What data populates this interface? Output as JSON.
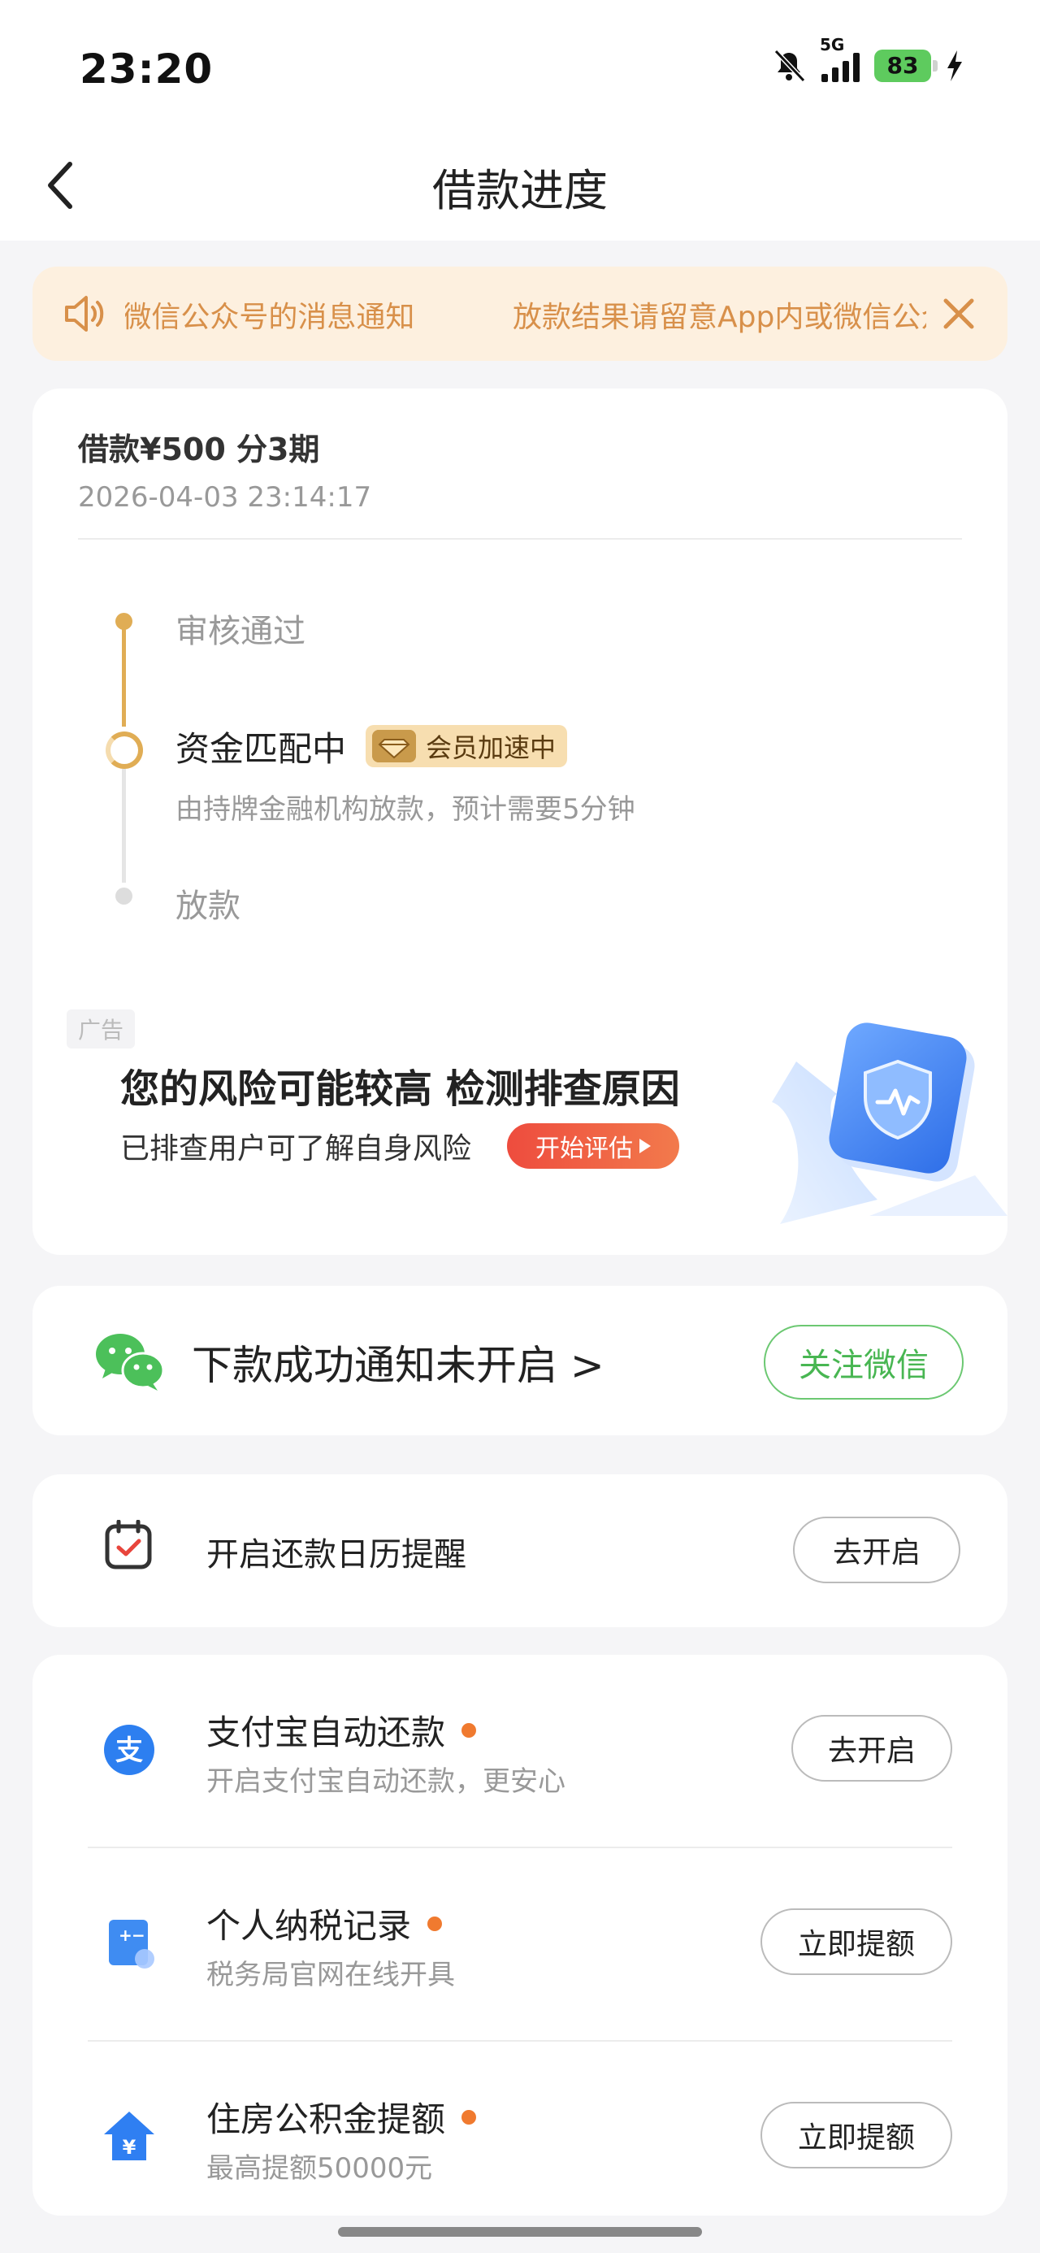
{
  "status_bar": {
    "time": "23:20",
    "network": "5G",
    "battery": "83"
  },
  "nav": {
    "title": "借款进度"
  },
  "notice": {
    "text": "放款结果请留意App内或微信公众号的消息通知"
  },
  "loan": {
    "title": "借款¥500  分3期",
    "time": "2026-04-03 23:14:17"
  },
  "progress": {
    "step1": "审核通过",
    "step2": "资金匹配中",
    "step2_badge": "会员加速中",
    "step2_sub": "由持牌金融机构放款，预计需要5分钟",
    "step3": "放款"
  },
  "ad": {
    "tag": "广告",
    "headline": "您的风险可能较高 检测排查原因",
    "sub": "已排查用户可了解自身风险",
    "button": "开始评估"
  },
  "wechat": {
    "text": "下款成功通知未开启 >",
    "button": "关注微信"
  },
  "calendar": {
    "text": "开启还款日历提醒",
    "button": "去开启"
  },
  "list": [
    {
      "title": "支付宝自动还款",
      "sub": "开启支付宝自动还款，更安心",
      "button": "去开启",
      "icon": "alipay-icon"
    },
    {
      "title": "个人纳税记录",
      "sub": "税务局官网在线开具",
      "button": "立即提额",
      "icon": "tax-icon"
    },
    {
      "title": "住房公积金提额",
      "sub": "最高提额50000元",
      "button": "立即提额",
      "icon": "housing-fund-icon"
    }
  ],
  "colors": {
    "accent_gold": "#e0ad55",
    "notice_text": "#d8904a",
    "wechat_green": "#48b652",
    "badge_dot": "#f07a2f",
    "ad_button": "#ee4c3e"
  }
}
